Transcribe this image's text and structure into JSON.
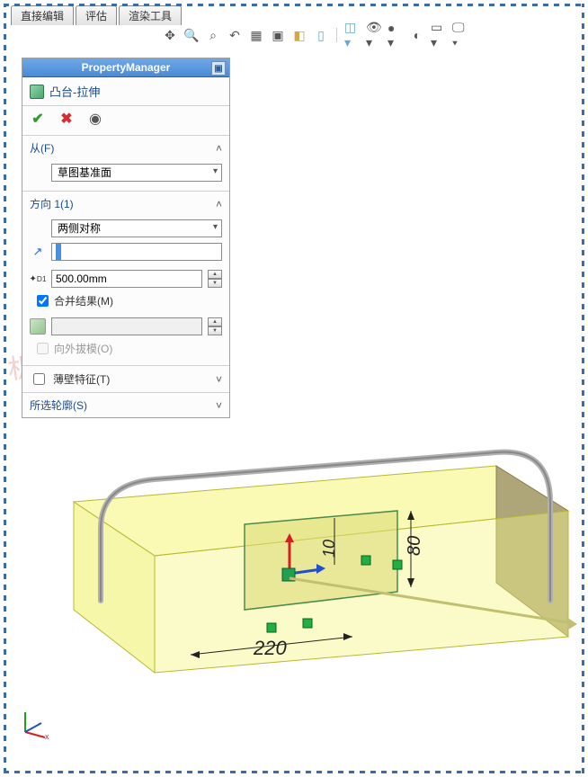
{
  "tabs": [
    "直接编辑",
    "评估",
    "渲染工具"
  ],
  "toolbar_icons": [
    "orient-icon",
    "zoom-fit-icon",
    "zoom-area-icon",
    "prev-view-icon",
    "section-icon",
    "display-style-icon",
    "scene-icon",
    "perspective-icon",
    "view-cube-icon",
    "hide-show-icon",
    "appearance-icon",
    "edit-appearance-icon",
    "apply-scene-icon",
    "view-settings-icon"
  ],
  "pm": {
    "title": "PropertyManager",
    "feature_label": "凸台-拉伸",
    "from": {
      "title": "从(F)",
      "value": "草图基准面"
    },
    "dir1": {
      "title": "方向 1(1)",
      "end_condition": "两侧对称",
      "depth_label": "D1",
      "depth_value": "500.00mm",
      "merge_label": "合并结果(M)",
      "merge_checked": true,
      "draft_label": "向外拔模(O)",
      "draft_checked": false
    },
    "thin": {
      "title": "薄壁特征(T)",
      "checked": false
    },
    "contours": {
      "title": "所选轮廓(S)"
    }
  },
  "dimensions": {
    "width": "220",
    "height_small": "10",
    "height": "80"
  },
  "watermark": "机械社"
}
